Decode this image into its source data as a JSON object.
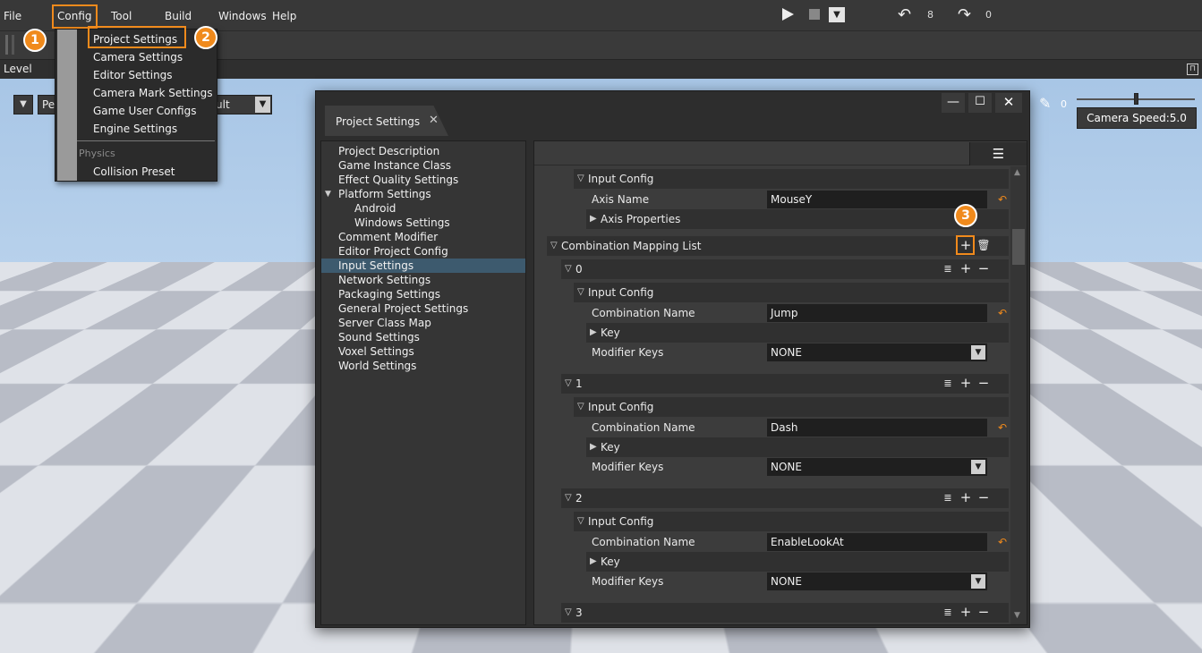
{
  "menubar": {
    "items": [
      "File",
      "Config",
      "Tool",
      "Build",
      "Windows",
      "Help"
    ]
  },
  "toolbar": {
    "undo_count": "8",
    "redo_count": "0"
  },
  "level_bar": {
    "title": "Level"
  },
  "viewport": {
    "left_dropdown_text": "Pe",
    "right_dropdown_text": "ult",
    "speed_value": "0",
    "camera_speed_label": "Camera Speed:5.0"
  },
  "config_menu": {
    "items": [
      "Project Settings",
      "Camera Settings",
      "Editor Settings",
      "Camera Mark Settings",
      "Game User Configs",
      "Engine Settings"
    ],
    "section": "Physics",
    "physics_items": [
      "Collision Preset"
    ]
  },
  "badges": [
    "1",
    "2",
    "3"
  ],
  "dialog": {
    "tab_title": "Project Settings",
    "tree": [
      {
        "label": "Project Description",
        "indent": 0
      },
      {
        "label": "Game Instance Class",
        "indent": 0
      },
      {
        "label": "Effect Quality Settings",
        "indent": 0
      },
      {
        "label": "Platform Settings",
        "indent": 0,
        "expanded": true
      },
      {
        "label": "Android",
        "indent": 1
      },
      {
        "label": "Windows Settings",
        "indent": 1
      },
      {
        "label": "Comment Modifier",
        "indent": 0
      },
      {
        "label": "Editor Project Config",
        "indent": 0
      },
      {
        "label": "Input Settings",
        "indent": 0,
        "selected": true
      },
      {
        "label": "Network Settings",
        "indent": 0
      },
      {
        "label": "Packaging Settings",
        "indent": 0
      },
      {
        "label": "General Project Settings",
        "indent": 0
      },
      {
        "label": "Server Class Map",
        "indent": 0
      },
      {
        "label": "Sound Settings",
        "indent": 0
      },
      {
        "label": "Voxel Settings",
        "indent": 0
      },
      {
        "label": "World Settings",
        "indent": 0
      }
    ],
    "props": {
      "input_config_label": "Input Config",
      "axis_name_label": "Axis Name",
      "axis_name_value": "MouseY",
      "axis_properties_label": "Axis Properties",
      "combination_list_label": "Combination Mapping List",
      "combination_name_label": "Combination Name",
      "key_label": "Key",
      "modifier_keys_label": "Modifier Keys",
      "entries": [
        {
          "index": "0",
          "combination_name": "Jump",
          "modifier_keys": "NONE"
        },
        {
          "index": "1",
          "combination_name": "Dash",
          "modifier_keys": "NONE"
        },
        {
          "index": "2",
          "combination_name": "EnableLookAt",
          "modifier_keys": "NONE"
        }
      ],
      "last_index": "3"
    }
  },
  "colors": {
    "accent": "#f08a1c",
    "selected_row": "#3d5a6e"
  }
}
